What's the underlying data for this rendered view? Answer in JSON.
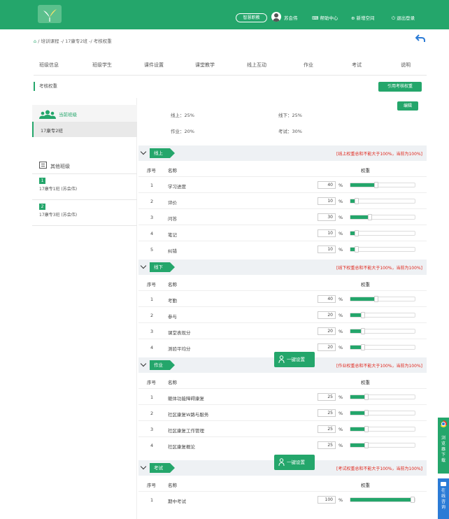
{
  "header": {
    "ai_button": "智慧职教",
    "user_name": "苏会伟",
    "nav": [
      {
        "icon": "help-center-icon",
        "label": "帮助中心"
      },
      {
        "icon": "new-space-icon",
        "label": "新增空间"
      },
      {
        "icon": "logout-icon",
        "label": "退出登录"
      }
    ],
    "colors": {
      "brand": "#24a66b",
      "warning": "#e0261b"
    }
  },
  "breadcrumb": {
    "home": "⌂",
    "items": [
      "/ 培训课程",
      "-/ 17康专2班",
      "-/ 考核权重"
    ]
  },
  "tabs": [
    "班级信息",
    "班级学生",
    "课件设置",
    "课堂教学",
    "线上互动",
    "作业",
    "考试",
    "说明"
  ],
  "page": {
    "subtitle": "考核权重",
    "apply_button": "引用考核权重",
    "edit_button": "编辑"
  },
  "sidebar": {
    "current_heading": "当前班级",
    "current_class": "17康专2班",
    "other_heading": "其他班级",
    "other_classes": [
      {
        "num": "1",
        "name": "17康专1班 (苏会伟)"
      },
      {
        "num": "2",
        "name": "17康专3班 (苏会伟)"
      }
    ]
  },
  "summary": {
    "online": "线上：25%",
    "offline": "线下：25%",
    "homework": "作业：20%",
    "exam": "考试：30%"
  },
  "table_headers": {
    "no": "序号",
    "name": "名称",
    "weight": "权重"
  },
  "onekey_label": "一键设置",
  "sections": [
    {
      "label": "线上",
      "warning": "[线上权重总和不能大于100%，当前为100%]",
      "rows": [
        {
          "no": "1",
          "name": "学习进度",
          "value": "40",
          "unit": "%",
          "fraction": 0.4
        },
        {
          "no": "2",
          "name": "评价",
          "value": "10",
          "unit": "%",
          "fraction": 0.1
        },
        {
          "no": "3",
          "name": "问答",
          "value": "30",
          "unit": "%",
          "fraction": 0.3
        },
        {
          "no": "4",
          "name": "笔记",
          "value": "10",
          "unit": "%",
          "fraction": 0.1
        },
        {
          "no": "5",
          "name": "纠错",
          "value": "10",
          "unit": "%",
          "fraction": 0.1
        }
      ]
    },
    {
      "label": "线下",
      "warning": "[线下权重总和不能大于100%，当前为100%]",
      "rows": [
        {
          "no": "1",
          "name": "考勤",
          "value": "40",
          "unit": "%",
          "fraction": 0.4
        },
        {
          "no": "2",
          "name": "参与",
          "value": "20",
          "unit": "%",
          "fraction": 0.2
        },
        {
          "no": "3",
          "name": "课堂表现分",
          "value": "20",
          "unit": "%",
          "fraction": 0.2
        },
        {
          "no": "4",
          "name": "测验平均分",
          "value": "20",
          "unit": "%",
          "fraction": 0.2
        }
      ]
    },
    {
      "label": "作业",
      "warning": "[作业权重总和不能大于100%，当前为100%]",
      "rows": [
        {
          "no": "1",
          "name": "躯体功能障碍康复",
          "value": "25",
          "unit": "%",
          "fraction": 0.25
        },
        {
          "no": "2",
          "name": "社区康复W路与服务",
          "value": "25",
          "unit": "%",
          "fraction": 0.25
        },
        {
          "no": "3",
          "name": "社区康复工作管理",
          "value": "25",
          "unit": "%",
          "fraction": 0.25
        },
        {
          "no": "4",
          "name": "社区康复概论",
          "value": "25",
          "unit": "%",
          "fraction": 0.25
        }
      ]
    },
    {
      "label": "考试",
      "warning": "[考试权重总和不能大于100%，当前为100%]",
      "rows": [
        {
          "no": "1",
          "name": "期中考试",
          "value": "100",
          "unit": "%",
          "fraction": 1.0
        }
      ]
    }
  ],
  "floating": {
    "download": "浏览器下载",
    "consult": "在线咨询"
  }
}
